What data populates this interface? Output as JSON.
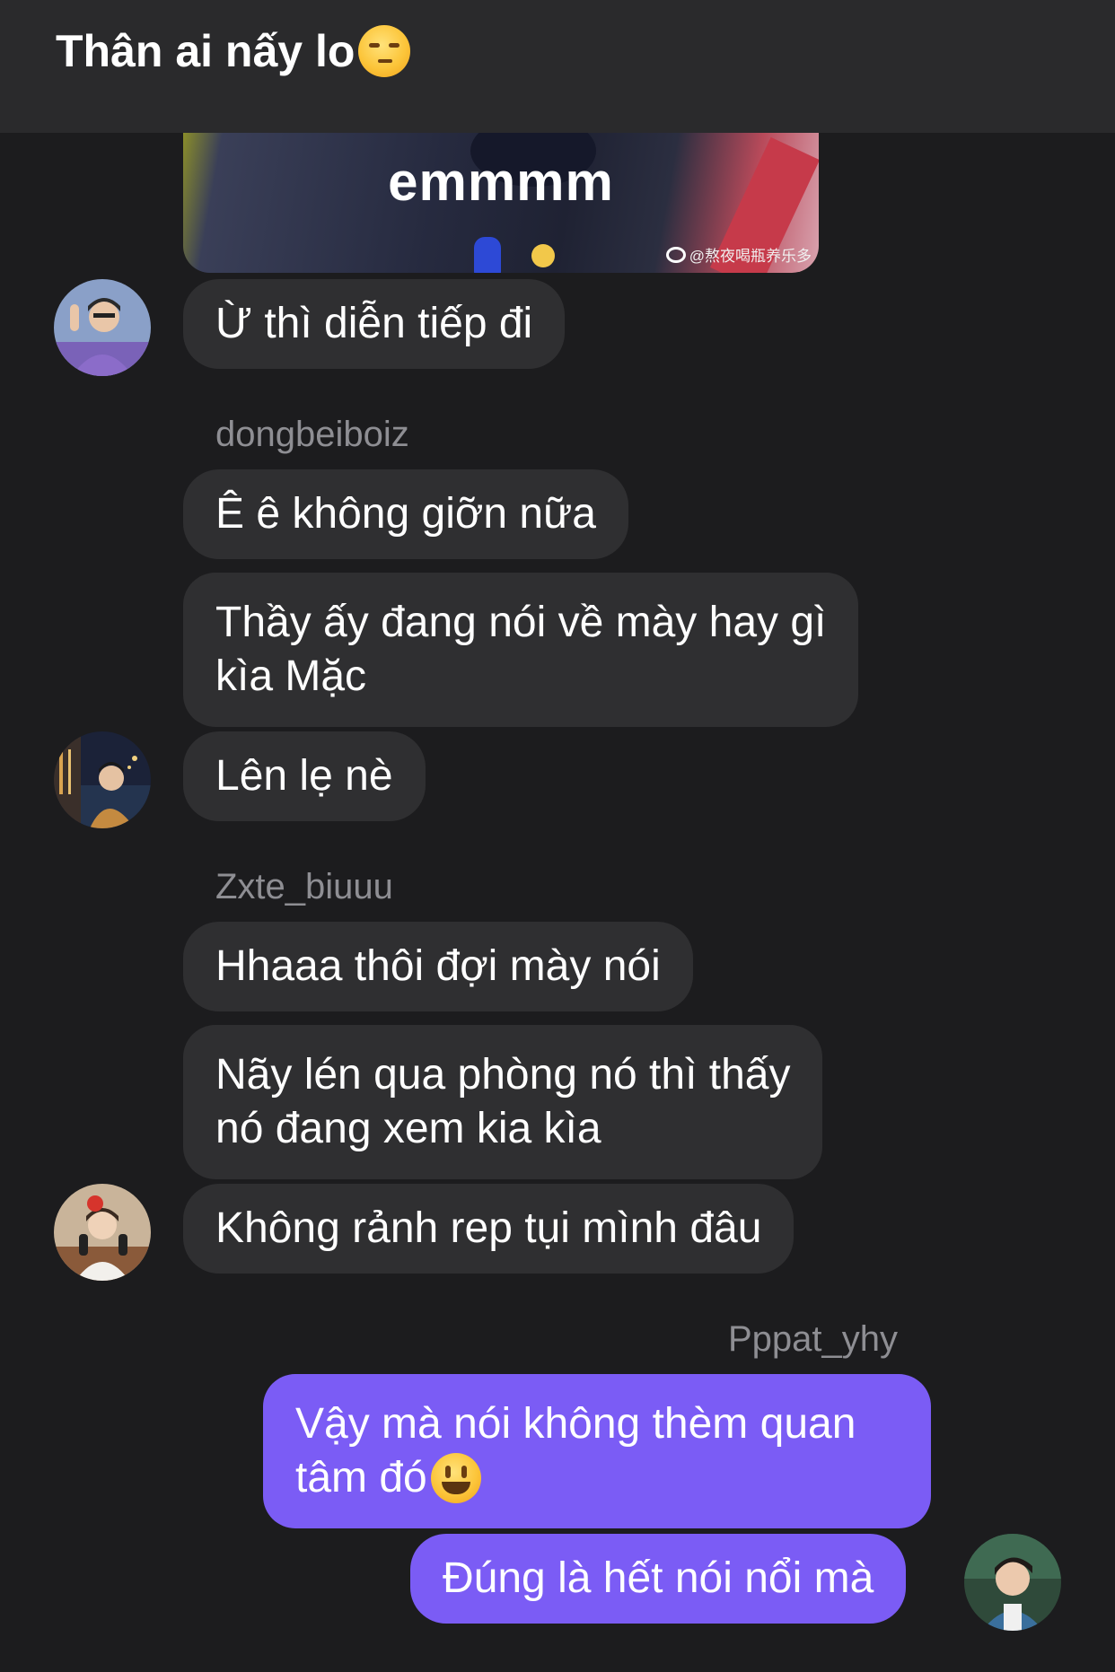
{
  "header": {
    "title": "Thân ai nấy lo",
    "title_emoji": "unamused-face-emoji"
  },
  "media": {
    "caption": "emmmm",
    "watermark": "@熬夜喝瓶养乐多",
    "watermark_icon": "weibo-icon"
  },
  "messages": [
    {
      "text": "Ừ thì diễn tiếp đi"
    },
    {
      "sender": "dongbeiboiz",
      "text": "Ê ê không giỡn nữa"
    },
    {
      "line1": "Thầy ấy đang nói về mày hay gì",
      "line2": "kìa Mặc"
    },
    {
      "text": "Lên lẹ nè"
    },
    {
      "sender": "Zxte_biuuu",
      "text": "Hhaaa thôi đợi mày nói"
    },
    {
      "line1": "Nãy lén qua phòng nó thì thấy",
      "line2": "nó đang xem kia kìa"
    },
    {
      "text": "Không rảnh rep tụi mình đâu"
    },
    {
      "sender": "Pppat_yhy",
      "line1": "Vậy mà nói không thèm quan",
      "line2": "tâm đó",
      "emoji": "grinning-face-emoji"
    },
    {
      "text": "Đúng là hết nói nổi mà"
    }
  ],
  "colors": {
    "background": "#1c1c1e",
    "header": "#2a2a2c",
    "bubble_other": "#2f2f31",
    "bubble_mine": "#7b5cf5",
    "sender_name": "#8e8e93"
  }
}
